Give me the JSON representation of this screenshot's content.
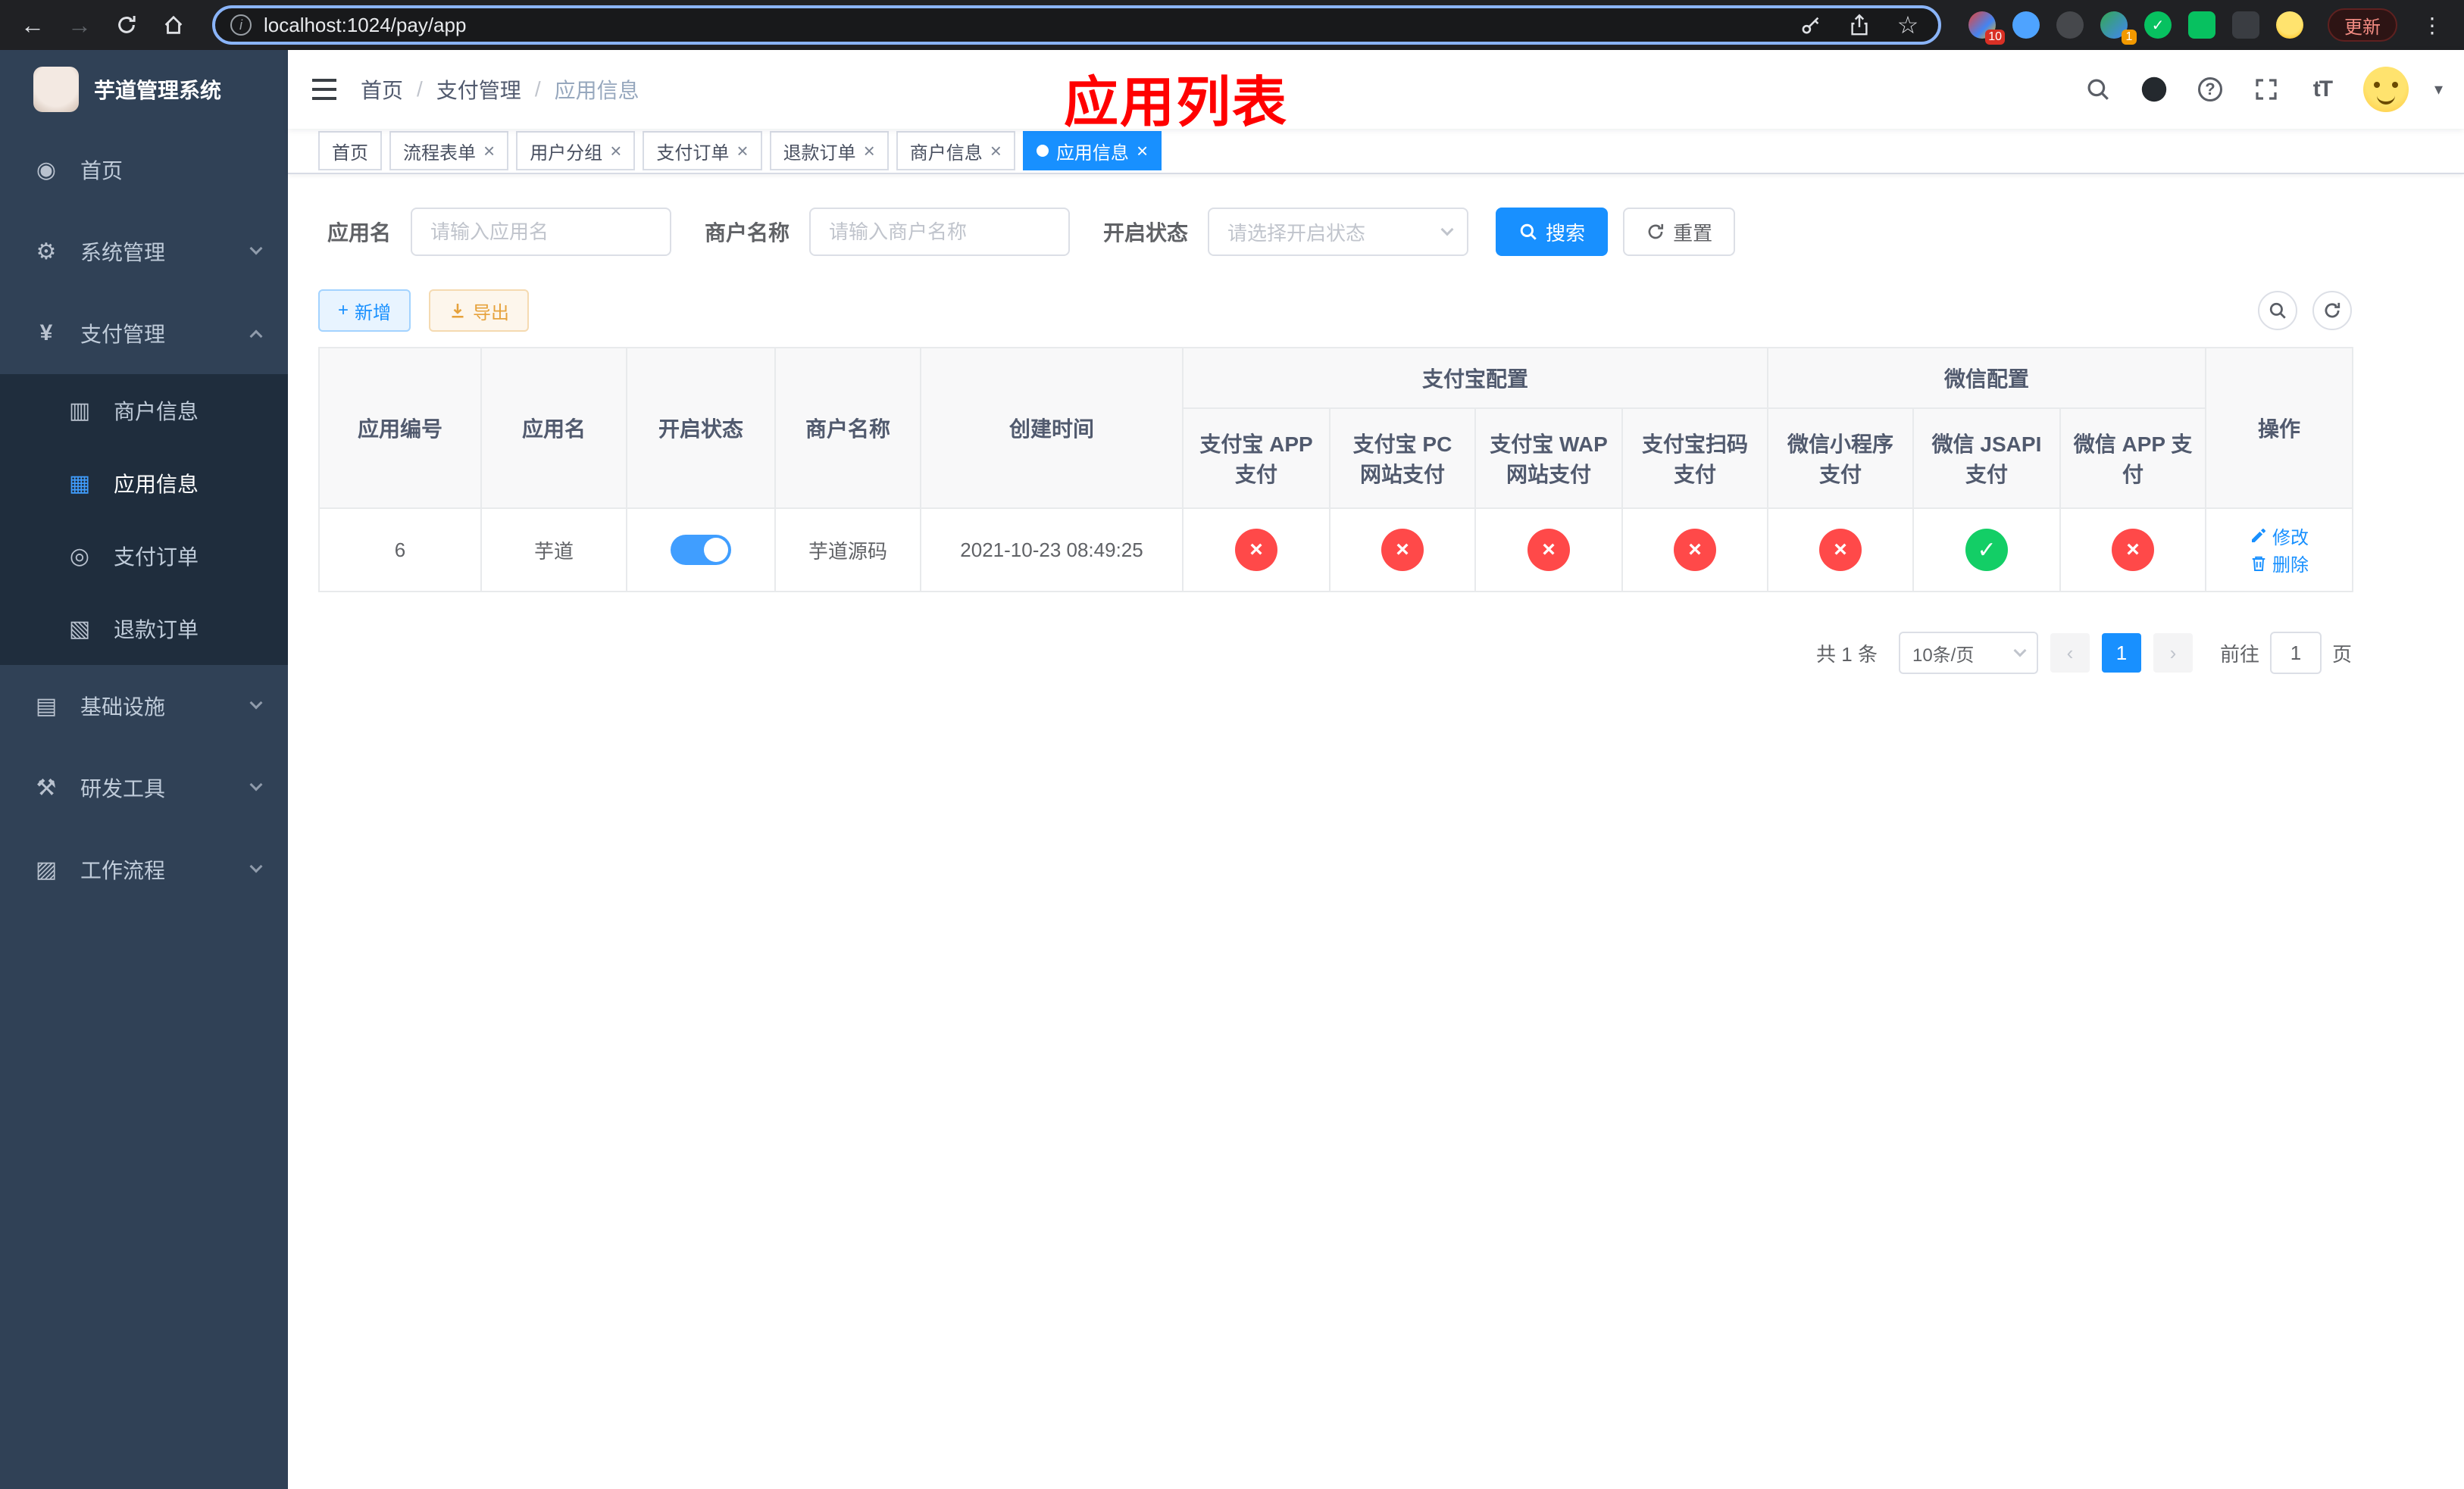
{
  "browser": {
    "url": "localhost:1024/pay/app",
    "update_label": "更新",
    "ext_badge_1": "10",
    "ext_badge_2": "1"
  },
  "sidebar": {
    "title": "芋道管理系统",
    "items": [
      {
        "label": "首页"
      },
      {
        "label": "系统管理"
      },
      {
        "label": "支付管理"
      },
      {
        "label": "基础设施"
      },
      {
        "label": "研发工具"
      },
      {
        "label": "工作流程"
      }
    ],
    "submenu": [
      {
        "label": "商户信息"
      },
      {
        "label": "应用信息"
      },
      {
        "label": "支付订单"
      },
      {
        "label": "退款订单"
      }
    ]
  },
  "header": {
    "breadcrumb": [
      "首页",
      "支付管理",
      "应用信息"
    ],
    "annotation": "应用列表"
  },
  "tabs": [
    {
      "label": "首页"
    },
    {
      "label": "流程表单"
    },
    {
      "label": "用户分组"
    },
    {
      "label": "支付订单"
    },
    {
      "label": "退款订单"
    },
    {
      "label": "商户信息"
    },
    {
      "label": "应用信息"
    }
  ],
  "filters": {
    "app_name_label": "应用名",
    "app_name_placeholder": "请输入应用名",
    "merchant_label": "商户名称",
    "merchant_placeholder": "请输入商户名称",
    "status_label": "开启状态",
    "status_placeholder": "请选择开启状态",
    "search_label": "搜索",
    "reset_label": "重置"
  },
  "toolbar": {
    "add_label": "新增",
    "export_label": "导出"
  },
  "table": {
    "groups": {
      "alipay": "支付宝配置",
      "wechat": "微信配置"
    },
    "columns": [
      "应用编号",
      "应用名",
      "开启状态",
      "商户名称",
      "创建时间",
      "支付宝 APP 支付",
      "支付宝 PC 网站支付",
      "支付宝 WAP 网站支付",
      "支付宝扫码支付",
      "微信小程序支付",
      "微信 JSAPI 支付",
      "微信 APP 支付",
      "操作"
    ],
    "rows": [
      {
        "id": "6",
        "name": "芋道",
        "enabled": true,
        "merchant": "芋道源码",
        "created": "2021-10-23 08:49:25",
        "statuses": [
          "no",
          "no",
          "no",
          "no",
          "no",
          "yes",
          "no"
        ],
        "edit_label": "修改",
        "delete_label": "删除"
      }
    ]
  },
  "pagination": {
    "total": "共 1 条",
    "page_size": "10条/页",
    "current_page": "1",
    "goto_prefix": "前往",
    "goto_value": "1",
    "goto_suffix": "页"
  },
  "colors": {
    "primary": "#1890ff",
    "danger": "#ff4949",
    "success": "#13ce66",
    "sidebar_bg": "#304156",
    "submenu_bg": "#1f2d3d",
    "annotation": "#ff0000"
  }
}
